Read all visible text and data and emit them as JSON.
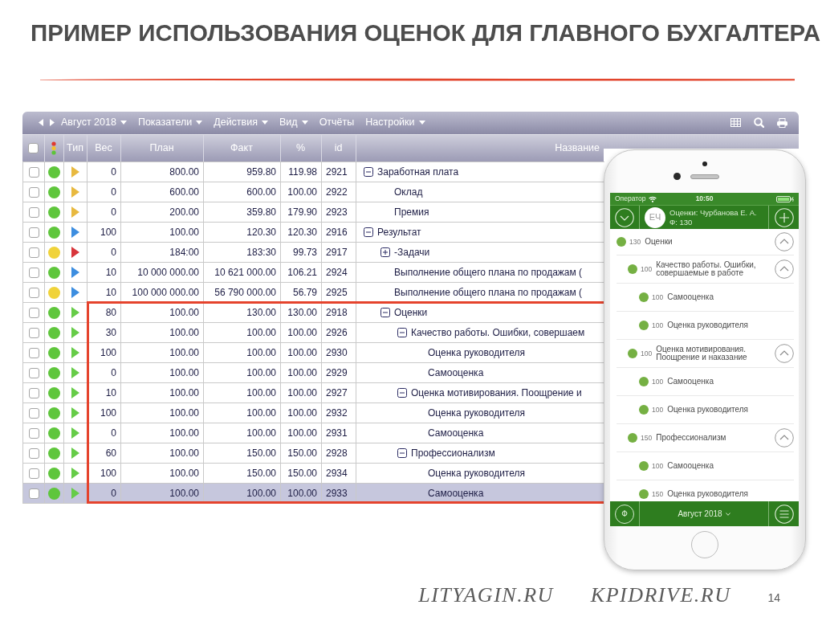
{
  "slide": {
    "title": "ПРИМЕР ИСПОЛЬЗОВАНИЯ ОЦЕНОК ДЛЯ ГЛАВНОГО БУХГАЛТЕРА",
    "footer_sites": [
      "LITYAGIN.RU",
      "KPIDRIVE.RU"
    ],
    "page_number": "14"
  },
  "app": {
    "toolbar": {
      "period": {
        "label": "Август 2018",
        "has_menu": true
      },
      "menus": [
        {
          "label": "Показатели",
          "has_menu": true
        },
        {
          "label": "Действия",
          "has_menu": true
        },
        {
          "label": "Вид",
          "has_menu": true
        },
        {
          "label": "Отчёты",
          "has_menu": false
        },
        {
          "label": "Настройки",
          "has_menu": true
        }
      ]
    },
    "table": {
      "header_checkbox": {
        "checked": false
      },
      "columns": [
        "Тип",
        "Вес",
        "План",
        "Факт",
        "%",
        "id",
        "Название"
      ],
      "rows": [
        {
          "checked": false,
          "status_dot": {
            "color": "#5fc63c"
          },
          "type_flag": {
            "color": "#e8b940"
          },
          "weight": "0",
          "plan": "800.00",
          "fact": "959.80",
          "percent": "119.98",
          "id": "2921",
          "name": "Заработная плата",
          "expanded": true,
          "selected": false,
          "framed": false,
          "children": [
            {
              "checked": false,
              "status_dot": {
                "color": "#5fc63c"
              },
              "type_flag": {
                "color": "#e8b940"
              },
              "weight": "0",
              "plan": "600.00",
              "fact": "600.00",
              "percent": "100.00",
              "id": "2922",
              "name": "Оклад",
              "selected": false,
              "framed": false
            },
            {
              "checked": false,
              "status_dot": {
                "color": "#5fc63c"
              },
              "type_flag": {
                "color": "#e8b940"
              },
              "weight": "0",
              "plan": "200.00",
              "fact": "359.80",
              "percent": "179.90",
              "id": "2923",
              "name": "Премия",
              "selected": false,
              "framed": false
            }
          ]
        },
        {
          "checked": false,
          "status_dot": {
            "color": "#5fc63c"
          },
          "type_flag": {
            "color": "#3d8ee0"
          },
          "weight": "100",
          "plan": "100.00",
          "fact": "120.30",
          "percent": "120.30",
          "id": "2916",
          "name": "Результат",
          "expanded": true,
          "selected": false,
          "framed": false,
          "children": [
            {
              "checked": false,
              "status_dot": {
                "color": "#f0d33a"
              },
              "type_flag": {
                "color": "#d8363c"
              },
              "weight": "0",
              "plan": "184:00",
              "fact": "183:30",
              "percent": "99.73",
              "id": "2917",
              "name": "-Задачи",
              "expanded": false,
              "selected": false,
              "framed": false
            },
            {
              "checked": false,
              "status_dot": {
                "color": "#5fc63c"
              },
              "type_flag": {
                "color": "#3d8ee0"
              },
              "weight": "10",
              "plan": "10 000 000.00",
              "fact": "10 621 000.00",
              "percent": "106.21",
              "id": "2924",
              "name": "Выполнение общего плана по продажам (",
              "selected": false,
              "framed": false
            },
            {
              "checked": false,
              "status_dot": {
                "color": "#f0d33a"
              },
              "type_flag": {
                "color": "#3d8ee0"
              },
              "weight": "10",
              "plan": "100 000 000.00",
              "fact": "56 790 000.00",
              "percent": "56.79",
              "id": "2925",
              "name": "Выполнение общего плана по продажам (",
              "selected": false,
              "framed": false
            },
            {
              "checked": false,
              "status_dot": {
                "color": "#5fc63c"
              },
              "type_flag": {
                "color": "#66cc48"
              },
              "weight": "80",
              "plan": "100.00",
              "fact": "130.00",
              "percent": "130.00",
              "id": "2918",
              "name": "Оценки",
              "expanded": true,
              "selected": false,
              "framed": true,
              "children": [
                {
                  "checked": false,
                  "status_dot": {
                    "color": "#5fc63c"
                  },
                  "type_flag": {
                    "color": "#66cc48"
                  },
                  "weight": "30",
                  "plan": "100.00",
                  "fact": "100.00",
                  "percent": "100.00",
                  "id": "2926",
                  "name": "Качество работы. Ошибки, совершаем",
                  "expanded": true,
                  "selected": false,
                  "framed": false,
                  "children": [
                    {
                      "checked": false,
                      "status_dot": {
                        "color": "#5fc63c"
                      },
                      "type_flag": {
                        "color": "#66cc48"
                      },
                      "weight": "100",
                      "plan": "100.00",
                      "fact": "100.00",
                      "percent": "100.00",
                      "id": "2930",
                      "name": "Оценка руководителя",
                      "selected": false,
                      "framed": false
                    },
                    {
                      "checked": false,
                      "status_dot": {
                        "color": "#5fc63c"
                      },
                      "type_flag": {
                        "color": "#66cc48"
                      },
                      "weight": "0",
                      "plan": "100.00",
                      "fact": "100.00",
                      "percent": "100.00",
                      "id": "2929",
                      "name": "Самооценка",
                      "selected": false,
                      "framed": false
                    }
                  ]
                },
                {
                  "checked": false,
                  "status_dot": {
                    "color": "#5fc63c"
                  },
                  "type_flag": {
                    "color": "#66cc48"
                  },
                  "weight": "10",
                  "plan": "100.00",
                  "fact": "100.00",
                  "percent": "100.00",
                  "id": "2927",
                  "name": "Оценка мотивирования. Поощрение и",
                  "expanded": true,
                  "selected": false,
                  "framed": false,
                  "children": [
                    {
                      "checked": false,
                      "status_dot": {
                        "color": "#5fc63c"
                      },
                      "type_flag": {
                        "color": "#66cc48"
                      },
                      "weight": "100",
                      "plan": "100.00",
                      "fact": "100.00",
                      "percent": "100.00",
                      "id": "2932",
                      "name": "Оценка руководителя",
                      "selected": false,
                      "framed": false
                    },
                    {
                      "checked": false,
                      "status_dot": {
                        "color": "#5fc63c"
                      },
                      "type_flag": {
                        "color": "#66cc48"
                      },
                      "weight": "0",
                      "plan": "100.00",
                      "fact": "100.00",
                      "percent": "100.00",
                      "id": "2931",
                      "name": "Самооценка",
                      "selected": false,
                      "framed": false
                    }
                  ]
                },
                {
                  "checked": false,
                  "status_dot": {
                    "color": "#5fc63c"
                  },
                  "type_flag": {
                    "color": "#66cc48"
                  },
                  "weight": "60",
                  "plan": "100.00",
                  "fact": "150.00",
                  "percent": "150.00",
                  "id": "2928",
                  "name": "Профессионализм",
                  "expanded": true,
                  "selected": false,
                  "framed": false,
                  "children": [
                    {
                      "checked": false,
                      "status_dot": {
                        "color": "#5fc63c"
                      },
                      "type_flag": {
                        "color": "#66cc48"
                      },
                      "weight": "100",
                      "plan": "100.00",
                      "fact": "150.00",
                      "percent": "150.00",
                      "id": "2934",
                      "name": "Оценка руководителя",
                      "selected": false,
                      "framed": false
                    },
                    {
                      "checked": false,
                      "status_dot": {
                        "color": "#5fc63c"
                      },
                      "type_flag": {
                        "color": "#66cc48"
                      },
                      "weight": "0",
                      "plan": "100.00",
                      "fact": "100.00",
                      "percent": "100.00",
                      "id": "2933",
                      "name": "Самооценка",
                      "selected": true,
                      "framed": false
                    }
                  ]
                }
              ]
            }
          ]
        }
      ]
    }
  },
  "phone": {
    "status_bar": {
      "carrier": "Оператор",
      "time": "10:50"
    },
    "header": {
      "avatar": "ЕЧ",
      "title": "Оценки: Чурбанова Е. А.",
      "subtitle": "Ф: 130"
    },
    "items": [
      {
        "value": "130",
        "label": "Оценки",
        "expanded": true,
        "children": [
          {
            "value": "100",
            "label": "Качество работы. Ошибки, совершаемые в работе",
            "expanded": true,
            "children": [
              {
                "value": "100",
                "label": "Самооценка"
              },
              {
                "value": "100",
                "label": "Оценка руководителя"
              }
            ]
          },
          {
            "value": "100",
            "label": "Оценка мотивирования. Поощрение и наказание",
            "expanded": true,
            "children": [
              {
                "value": "100",
                "label": "Самооценка"
              },
              {
                "value": "100",
                "label": "Оценка руководителя"
              }
            ]
          },
          {
            "value": "150",
            "label": "Профессионализм",
            "expanded": true,
            "children": [
              {
                "value": "100",
                "label": "Самооценка"
              },
              {
                "value": "150",
                "label": "Оценка руководителя"
              }
            ]
          }
        ]
      }
    ],
    "bottom_bar": {
      "left_button": "Ф",
      "period": "Август 2018"
    }
  }
}
